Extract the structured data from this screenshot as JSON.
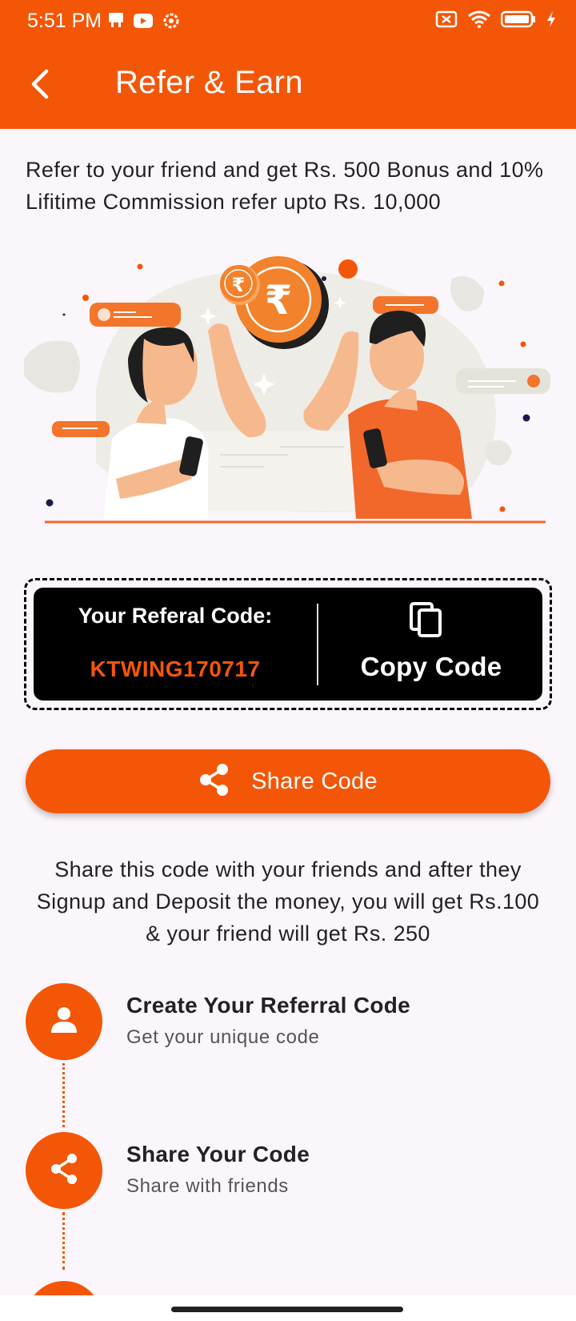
{
  "status_bar": {
    "time": "5:51 PM",
    "left_icons": [
      "notification-icon",
      "youtube-icon",
      "settings-icon"
    ],
    "right_icons": [
      "no-sim-icon",
      "wifi-icon",
      "battery-icon",
      "charging-icon"
    ]
  },
  "app_bar": {
    "title": "Refer & Earn",
    "back_icon": "back-arrow-icon"
  },
  "intro_text": "Refer to your friend and get Rs. 500 Bonus and 10% Lifitime Commission refer upto Rs. 10,000",
  "referral": {
    "label": "Your Referal Code:",
    "code": "KTWING170717",
    "copy_label": "Copy Code",
    "copy_icon": "copy-icon"
  },
  "share_button": {
    "label": "Share Code",
    "icon": "share-icon"
  },
  "share_note": "Share this code with your friends and after they Signup and Deposit the money, you will get  Rs.100 & your friend will get Rs. 250",
  "steps": [
    {
      "title": "Create Your Referral Code",
      "subtitle": "Get your unique code",
      "icon": "person-icon"
    },
    {
      "title": "Share Your Code",
      "subtitle": "Share with friends",
      "icon": "share-icon"
    }
  ],
  "colors": {
    "primary": "#f45608",
    "background": "#fbf6fb",
    "code_box": "#000000"
  }
}
